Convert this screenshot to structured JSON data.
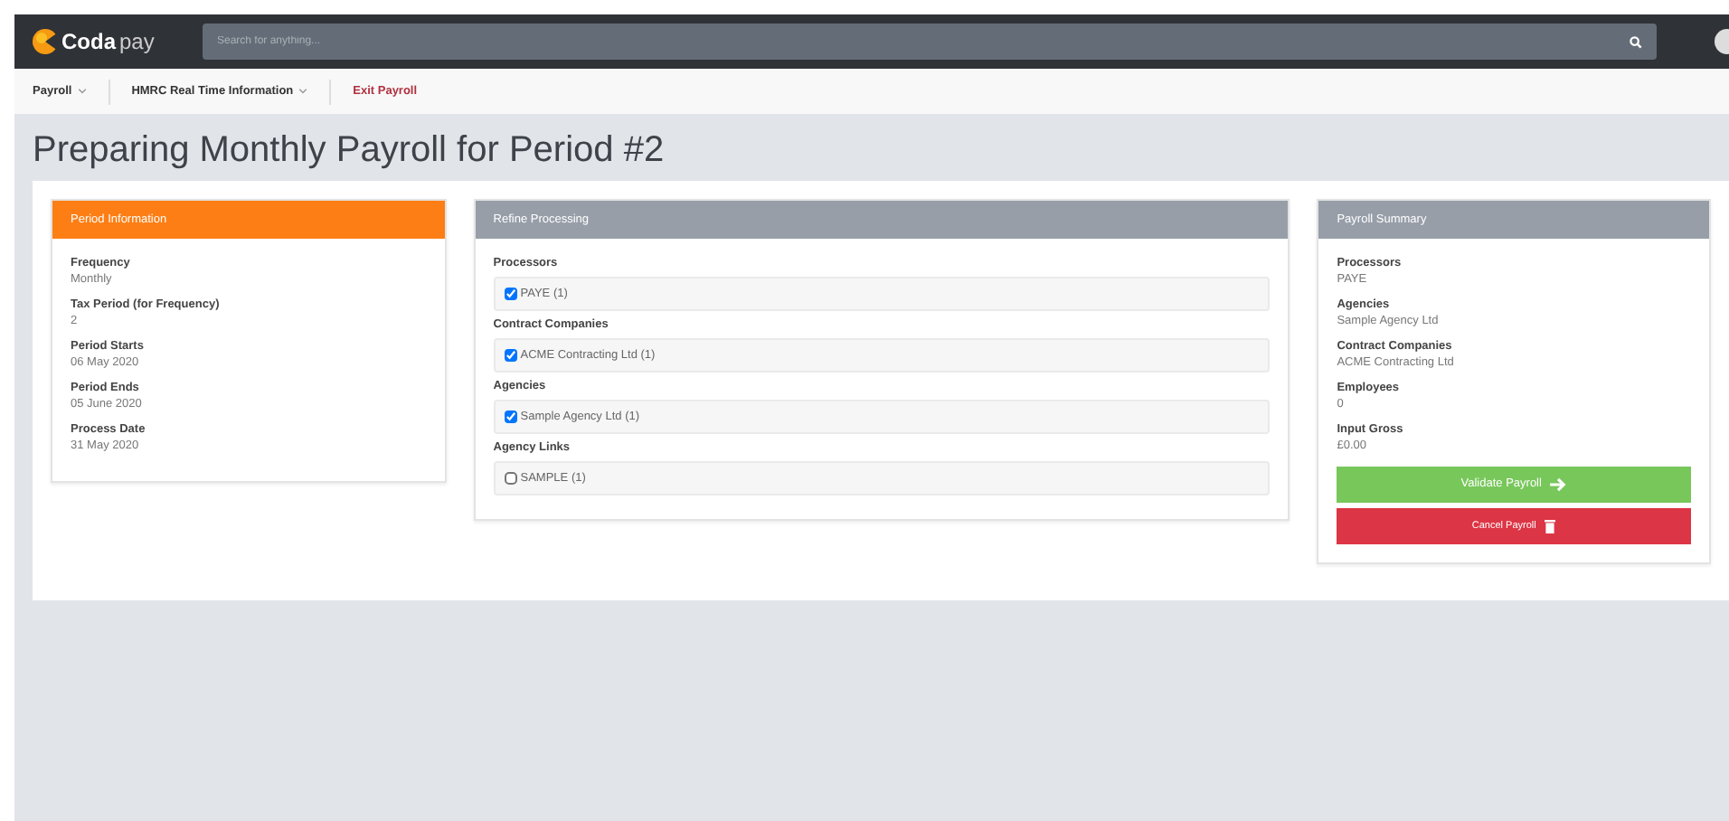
{
  "header": {
    "logo": {
      "word": "Coda",
      "suffix": "pay"
    },
    "search": {
      "placeholder": "Search for anything..."
    }
  },
  "subnav": [
    {
      "label": "Payroll",
      "kind": "dropdown"
    },
    {
      "label": "HMRC Real Time Information",
      "kind": "dropdown"
    },
    {
      "label": "Exit Payroll",
      "kind": "link"
    }
  ],
  "page_title": "Preparing Monthly Payroll for Period #2",
  "period_information": {
    "title": "Period Information",
    "fields": [
      {
        "label": "Frequency",
        "value": "Monthly"
      },
      {
        "label": "Tax Period (for Frequency)",
        "value": "2"
      },
      {
        "label": "Period Starts",
        "value": "06 May 2020"
      },
      {
        "label": "Period Ends",
        "value": "05 June 2020"
      },
      {
        "label": "Process Date",
        "value": "31 May 2020"
      }
    ]
  },
  "refine_processing": {
    "title": "Refine Processing",
    "groups": [
      {
        "label": "Processors",
        "options": [
          {
            "label": "PAYE (1)",
            "checked": true
          }
        ]
      },
      {
        "label": "Contract Companies",
        "options": [
          {
            "label": "ACME Contracting Ltd (1)",
            "checked": true
          }
        ]
      },
      {
        "label": "Agencies",
        "options": [
          {
            "label": "Sample Agency Ltd (1)",
            "checked": true
          }
        ]
      },
      {
        "label": "Agency Links",
        "options": [
          {
            "label": "SAMPLE (1)",
            "checked": false
          }
        ]
      }
    ]
  },
  "payroll_summary": {
    "title": "Payroll Summary",
    "fields": [
      {
        "label": "Processors",
        "value": "PAYE"
      },
      {
        "label": "Agencies",
        "value": "Sample Agency Ltd"
      },
      {
        "label": "Contract Companies",
        "value": "ACME Contracting Ltd"
      },
      {
        "label": "Employees",
        "value": "0"
      },
      {
        "label": "Input Gross",
        "value": "£0.00"
      }
    ],
    "buttons": [
      {
        "label": "Validate Payroll",
        "kind": "validate"
      },
      {
        "label": "Cancel Payroll",
        "kind": "cancel"
      }
    ]
  }
}
